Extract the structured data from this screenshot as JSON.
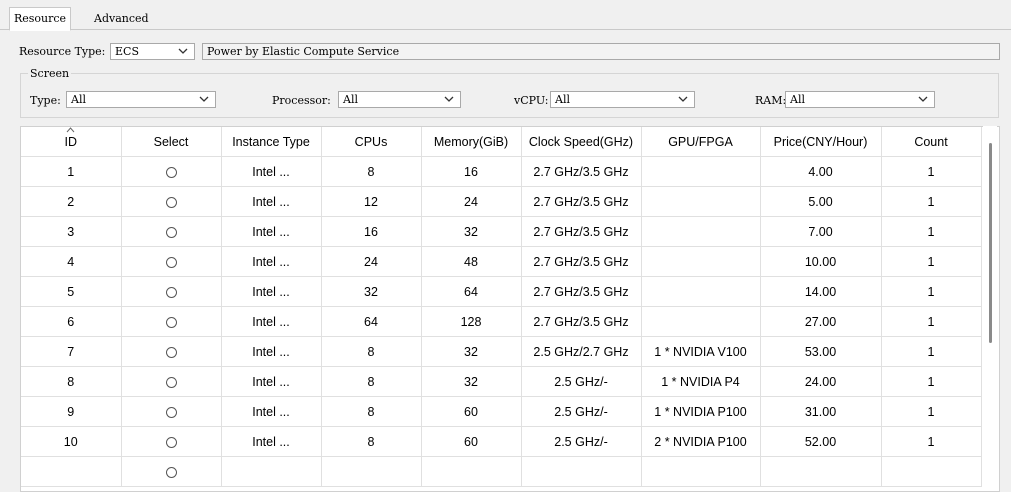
{
  "tabs": [
    {
      "label": "Resource",
      "active": true
    },
    {
      "label": "Advanced",
      "active": false
    }
  ],
  "resource_type": {
    "label": "Resource Type:",
    "value": "ECS",
    "description": "Power by Elastic Compute Service"
  },
  "screen": {
    "title": "Screen",
    "filters": [
      {
        "label": "Type:",
        "value": "All"
      },
      {
        "label": "Processor:",
        "value": "All"
      },
      {
        "label": "vCPU:",
        "value": "All"
      },
      {
        "label": "RAM:",
        "value": "All"
      }
    ]
  },
  "table": {
    "columns": [
      "ID",
      "Select",
      "Instance Type",
      "CPUs",
      "Memory(GiB)",
      "Clock Speed(GHz)",
      "GPU/FPGA",
      "Price(CNY/Hour)",
      "Count"
    ],
    "rows": [
      {
        "id": "1",
        "type": "Intel ...",
        "cpus": "8",
        "mem": "16",
        "clock": "2.7 GHz/3.5 GHz",
        "gpu": "",
        "price": "4.00",
        "count": "1"
      },
      {
        "id": "2",
        "type": "Intel ...",
        "cpus": "12",
        "mem": "24",
        "clock": "2.7 GHz/3.5 GHz",
        "gpu": "",
        "price": "5.00",
        "count": "1"
      },
      {
        "id": "3",
        "type": "Intel ...",
        "cpus": "16",
        "mem": "32",
        "clock": "2.7 GHz/3.5 GHz",
        "gpu": "",
        "price": "7.00",
        "count": "1"
      },
      {
        "id": "4",
        "type": "Intel ...",
        "cpus": "24",
        "mem": "48",
        "clock": "2.7 GHz/3.5 GHz",
        "gpu": "",
        "price": "10.00",
        "count": "1"
      },
      {
        "id": "5",
        "type": "Intel ...",
        "cpus": "32",
        "mem": "64",
        "clock": "2.7 GHz/3.5 GHz",
        "gpu": "",
        "price": "14.00",
        "count": "1"
      },
      {
        "id": "6",
        "type": "Intel ...",
        "cpus": "64",
        "mem": "128",
        "clock": "2.7 GHz/3.5 GHz",
        "gpu": "",
        "price": "27.00",
        "count": "1"
      },
      {
        "id": "7",
        "type": "Intel ...",
        "cpus": "8",
        "mem": "32",
        "clock": "2.5 GHz/2.7 GHz",
        "gpu": "1 * NVIDIA V100",
        "price": "53.00",
        "count": "1"
      },
      {
        "id": "8",
        "type": "Intel ...",
        "cpus": "8",
        "mem": "32",
        "clock": "2.5 GHz/-",
        "gpu": "1 * NVIDIA P4",
        "price": "24.00",
        "count": "1"
      },
      {
        "id": "9",
        "type": "Intel ...",
        "cpus": "8",
        "mem": "60",
        "clock": "2.5 GHz/-",
        "gpu": "1 * NVIDIA P100",
        "price": "31.00",
        "count": "1"
      },
      {
        "id": "10",
        "type": "Intel ...",
        "cpus": "8",
        "mem": "60",
        "clock": "2.5 GHz/-",
        "gpu": "2 * NVIDIA P100",
        "price": "52.00",
        "count": "1"
      }
    ]
  },
  "colors": {
    "border": "#a9a9a9",
    "panel": "#f0f0f0"
  }
}
